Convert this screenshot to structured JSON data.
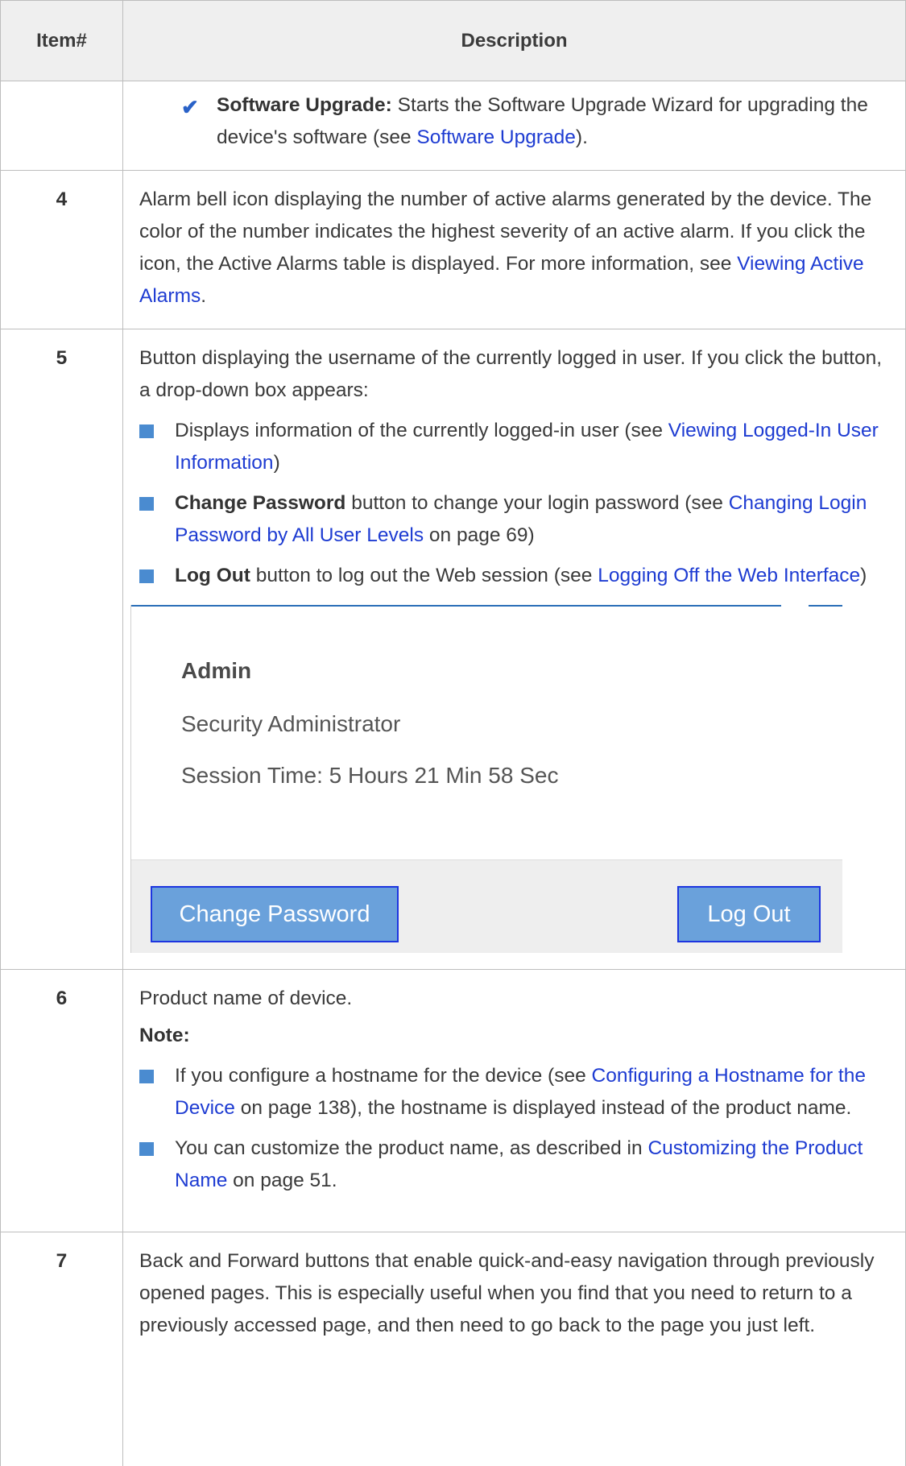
{
  "header": {
    "item_col": "Item#",
    "desc_col": "Description"
  },
  "row_upgrade": {
    "check_label": "Software Upgrade:",
    "text1": " Starts the Software Upgrade Wizard for upgrading the device's software (see ",
    "link": "Software Upgrade",
    "text2": ")."
  },
  "row4": {
    "num": "4",
    "text1": "Alarm bell icon displaying the number of active alarms generated by the device. The color of the number indicates the highest severity of an active alarm. If you click the icon, the Active Alarms table is displayed. For more information, see ",
    "link": "Viewing Active Alarms",
    "text2": "."
  },
  "row5": {
    "num": "5",
    "intro": "Button displaying the username of the currently logged in user. If you click the button, a drop-down box appears:",
    "b1_text": "Displays information of the currently logged-in user (see ",
    "b1_link": "Viewing Logged-In User Information",
    "b1_end": ")",
    "b2_bold": "Change Password",
    "b2_text": " button to change your login password (see ",
    "b2_link": "Changing Login Password by All User Levels",
    "b2_end": " on page 69)",
    "b3_bold": "Log Out",
    "b3_text": " button to log out the Web session (see ",
    "b3_link": "Logging Off the Web Interface",
    "b3_end": ")",
    "screenshot": {
      "user": "Admin",
      "role": "Security Administrator",
      "session": "Session Time: 5 Hours 21 Min 58 Sec",
      "change_password_btn": "Change Password",
      "logout_btn": "Log Out"
    }
  },
  "row6": {
    "num": "6",
    "intro": "Product name of device.",
    "note": "Note:",
    "b1_text": "If you configure a hostname for the device (see ",
    "b1_link": "Configuring a Hostname for the Device",
    "b1_end": " on page 138), the hostname is displayed instead of the product name.",
    "b2_text": "You can customize the product name, as described in ",
    "b2_link": "Customizing the Product Name",
    "b2_end": " on page 51."
  },
  "row7": {
    "num": "7",
    "text": "Back and Forward buttons that enable quick-and-easy navigation through previously opened pages. This is especially useful when you find that you need to return to a previously accessed page, and then need to go back to the page you just left."
  }
}
